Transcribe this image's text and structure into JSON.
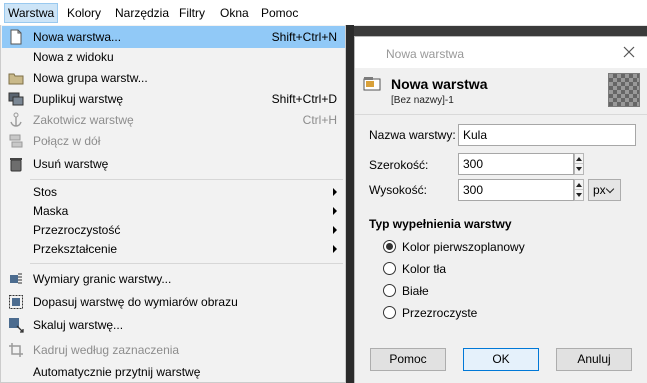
{
  "menubar": {
    "items": [
      "Warstwa",
      "Kolory",
      "Narzędzia",
      "Filtry",
      "Okna",
      "Pomoc"
    ]
  },
  "menu": {
    "items": [
      {
        "label": "Nowa warstwa...",
        "shortcut": "Shift+Ctrl+N",
        "icon": "new-layer-icon",
        "highlighted": true
      },
      {
        "label": "Nowa z widoku",
        "shortcut": "",
        "icon": ""
      },
      {
        "label": "Nowa grupa warstw...",
        "shortcut": "",
        "icon": "folder-icon"
      },
      {
        "label": "Duplikuj warstwę",
        "shortcut": "Shift+Ctrl+D",
        "icon": "duplicate-icon"
      },
      {
        "label": "Zakotwicz warstwę",
        "shortcut": "Ctrl+H",
        "icon": "anchor-icon",
        "disabled": true
      },
      {
        "label": "Połącz w dół",
        "shortcut": "",
        "icon": "merge-down-icon",
        "disabled": true
      },
      {
        "label": "Usuń warstwę",
        "shortcut": "",
        "icon": "trash-icon"
      },
      {
        "label": "Stos",
        "submenu": true
      },
      {
        "label": "Maska",
        "submenu": true
      },
      {
        "label": "Przezroczystość",
        "submenu": true
      },
      {
        "label": "Przekształcenie",
        "submenu": true
      },
      {
        "label": "Wymiary granic warstwy...",
        "icon": "layer-boundary-icon"
      },
      {
        "label": "Dopasuj warstwę do wymiarów obrazu",
        "icon": "fit-layer-icon"
      },
      {
        "label": "Skaluj warstwę...",
        "icon": "scale-layer-icon"
      },
      {
        "label": "Kadruj według zaznaczenia",
        "icon": "crop-icon",
        "disabled": true
      },
      {
        "label": "Automatycznie przytnij warstwę",
        "icon": ""
      }
    ]
  },
  "dialog": {
    "window_title": "Nowa warstwa",
    "header_title": "Nowa warstwa",
    "header_subtitle": "[Bez nazwy]-1",
    "name_label": "Nazwa warstwy:",
    "name_value": "Kula",
    "width_label": "Szerokość:",
    "width_value": "300",
    "height_label": "Wysokość:",
    "height_value": "300",
    "unit": "px",
    "fill_section_title": "Typ wypełnienia warstwy",
    "fill_options": [
      "Kolor pierwszoplanowy",
      "Kolor tła",
      "Białe",
      "Przezroczyste"
    ],
    "fill_selected": "Kolor pierwszoplanowy",
    "buttons": {
      "help": "Pomoc",
      "ok": "OK",
      "cancel": "Anuluj"
    }
  },
  "colors": {
    "menu_highlight": "#91c9f7",
    "menubar_active": "#cce4f7",
    "canvas_dark": "#3b3b3b",
    "dialog_bg": "#f0f0f0"
  }
}
